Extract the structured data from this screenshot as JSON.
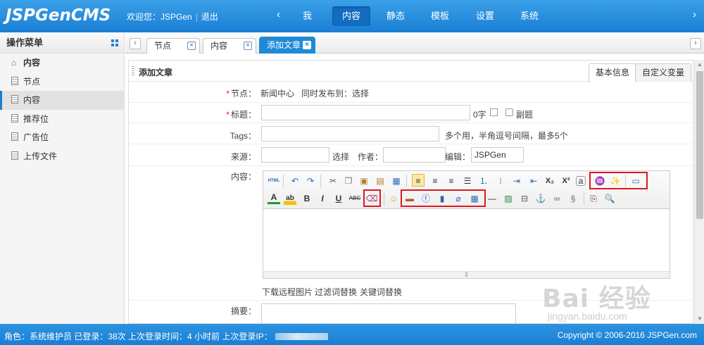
{
  "app": {
    "logo": "JSPGenCMS"
  },
  "header": {
    "welcome": "欢迎您：JSPGen",
    "logout": "退出",
    "nav": [
      "我",
      "内容",
      "静态",
      "模板",
      "设置",
      "系统"
    ],
    "nav_active": "内容"
  },
  "sidebar": {
    "title": "操作菜单",
    "items": [
      {
        "label": "内容",
        "type": "root"
      },
      {
        "label": "节点"
      },
      {
        "label": "内容",
        "active": true
      },
      {
        "label": "推荐位"
      },
      {
        "label": "广告位"
      },
      {
        "label": "上传文件"
      }
    ]
  },
  "tabs": [
    {
      "label": "节点"
    },
    {
      "label": "内容"
    },
    {
      "label": "添加文章",
      "active": true
    }
  ],
  "panel": {
    "title": "添加文章",
    "view_tabs": [
      "基本信息",
      "自定义变量"
    ],
    "node": {
      "label": "节点：",
      "value": "新闻中心",
      "sync": "同时发布到：选择"
    },
    "title_field": {
      "label": "标题：",
      "value": "",
      "count": "0字",
      "bold": "副题"
    },
    "tags": {
      "label": "Tags：",
      "value": "",
      "hint": "多个用，半角逗号间隔，最多5个"
    },
    "source": {
      "label": "来源：",
      "value": "",
      "select": "选择",
      "author_label": "作者：",
      "author_value": "",
      "editor_label": "编辑：",
      "editor_value": "JSPGen"
    },
    "content": {
      "label": "内容：",
      "tools": [
        "下载远程图片",
        "过滤词替换",
        "关键词替换"
      ]
    },
    "summary": {
      "label": "摘要："
    }
  },
  "editor_toolbar": {
    "row1": [
      "html-source-icon",
      "undo-icon",
      "redo-icon",
      "cut-icon",
      "copy-icon",
      "paste-icon",
      "paste-text-icon",
      "paste-word-icon",
      "align-left-icon",
      "align-center-icon",
      "align-right-icon",
      "justify-icon",
      "ordered-list-icon",
      "unordered-list-icon",
      "indent-icon",
      "outdent-icon",
      "subscript-icon",
      "superscript-icon",
      "anchor-a-icon",
      "format-clear-brush-icon",
      "quick-format-icon",
      "preview-icon"
    ],
    "row2": [
      "font-color-icon",
      "highlight-icon",
      "bold-icon",
      "italic-icon",
      "underline-icon",
      "strikethrough-icon",
      "eraser-icon",
      "emoticon-icon",
      "image-icon",
      "flash-icon",
      "media-icon",
      "attachment-icon",
      "table-icon",
      "hr-icon",
      "image-manager-icon",
      "pagebreak-icon",
      "anchor-icon",
      "link-icon",
      "unlink-icon",
      "template-icon",
      "search-replace-icon"
    ],
    "glyphs": {
      "sub": "X₂",
      "sup": "X²",
      "bold": "B",
      "italic": "I",
      "underline": "U",
      "strike": "ABC",
      "a": "a"
    }
  },
  "footer": {
    "status": "角色：系统维护员  已登录：38次  上次登录时间：4 小时前  上次登录IP：",
    "copyright": "Copyright © 2006-2016 JSPGen.com"
  },
  "watermark": {
    "brand": "Bai 经验",
    "url": "jingyan.baidu.com"
  }
}
